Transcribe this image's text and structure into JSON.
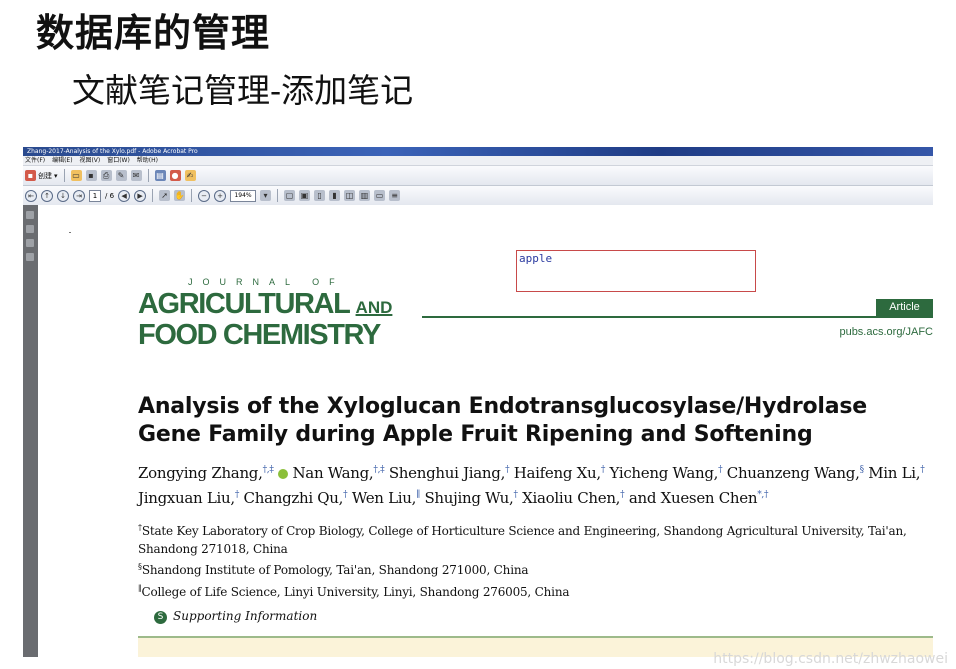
{
  "slide": {
    "title": "数据库的管理",
    "subtitle": "文献笔记管理-添加笔记"
  },
  "window": {
    "title": "Zhang-2017-Analysis of the Xylo.pdf - Adobe Acrobat Pro",
    "menu": [
      "文件(F)",
      "编辑(E)",
      "视图(V)",
      "窗口(W)",
      "帮助(H)"
    ],
    "create_label": "创建",
    "page_current": "1",
    "page_total": "/ 6",
    "zoom": "194%"
  },
  "comment": {
    "text": "apple"
  },
  "journal": {
    "line1": "JOURNAL OF",
    "line2_a": "AGRICULTURAL ",
    "line2_and": "AND",
    "line3": "FOOD CHEMISTRY",
    "badge": "Article",
    "url": "pubs.acs.org/JAFC"
  },
  "article": {
    "title": "Analysis of the Xyloglucan Endotransglucosylase/Hydrolase Gene Family during Apple Fruit Ripening and Softening",
    "authors": [
      {
        "name": "Zongying Zhang,",
        "sup": "†,‡",
        "orcid": true
      },
      {
        "name": "Nan Wang,",
        "sup": "†,‡"
      },
      {
        "name": "Shenghui Jiang,",
        "sup": "†"
      },
      {
        "name": "Haifeng Xu,",
        "sup": "†"
      },
      {
        "name": "Yicheng Wang,",
        "sup": "†"
      },
      {
        "name": "Chuanzeng Wang,",
        "sup": "§"
      },
      {
        "name": "Min Li,",
        "sup": "†"
      },
      {
        "name": "Jingxuan Liu,",
        "sup": "†"
      },
      {
        "name": "Changzhi Qu,",
        "sup": "†"
      },
      {
        "name": "Wen Liu,",
        "sup": "∥"
      },
      {
        "name": "Shujing Wu,",
        "sup": "†"
      },
      {
        "name": "Xiaoliu Chen,",
        "sup": "†"
      },
      {
        "name": "and Xuesen Chen",
        "sup": "*,†"
      }
    ],
    "affiliations": [
      {
        "mark": "†",
        "text": "State Key Laboratory of Crop Biology, College of Horticulture Science and Engineering, Shandong Agricultural University, Tai'an, Shandong 271018, China"
      },
      {
        "mark": "§",
        "text": "Shandong Institute of Pomology, Tai'an, Shandong 271000, China"
      },
      {
        "mark": "∥",
        "text": "College of Life Science, Linyi University, Linyi, Shandong 276005, China"
      }
    ],
    "supporting": "Supporting Information",
    "supporting_icon": "S"
  },
  "watermark": "https://blog.csdn.net/zhwzhaowei"
}
